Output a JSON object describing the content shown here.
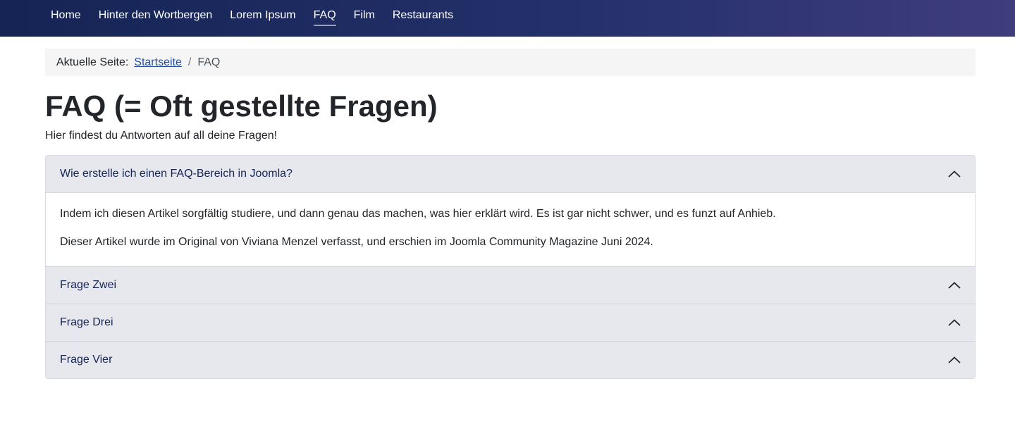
{
  "nav": {
    "items": [
      {
        "label": "Home",
        "active": false
      },
      {
        "label": "Hinter den Wortbergen",
        "active": false
      },
      {
        "label": "Lorem Ipsum",
        "active": false
      },
      {
        "label": "FAQ",
        "active": true
      },
      {
        "label": "Film",
        "active": false
      },
      {
        "label": "Restaurants",
        "active": false
      }
    ]
  },
  "breadcrumb": {
    "label": "Aktuelle Seite:",
    "home": "Startseite",
    "separator": "/",
    "current": "FAQ"
  },
  "page": {
    "title": "FAQ (= Oft gestellte Fragen)",
    "intro": "Hier findest du Antworten auf all deine Fragen!"
  },
  "accordion": {
    "items": [
      {
        "question": "Wie erstelle ich einen FAQ-Bereich in Joomla?",
        "expanded": true,
        "answer": [
          "Indem ich diesen Artikel sorgfältig studiere, und dann genau das machen, was hier erklärt wird. Es ist gar nicht schwer, und es funzt auf Anhieb.",
          "Dieser Artikel wurde im Original von Viviana Menzel verfasst, und erschien im Joomla Community Magazine Juni 2024."
        ]
      },
      {
        "question": "Frage Zwei",
        "expanded": false
      },
      {
        "question": "Frage Drei",
        "expanded": false
      },
      {
        "question": "Frage Vier",
        "expanded": false
      }
    ]
  },
  "colors": {
    "nav_start": "#152454",
    "nav_end": "#3f3d7c",
    "link": "#264d9b",
    "accordion_header": "#e7e8ee",
    "accordion_title": "#152454"
  },
  "icons": {
    "accordion_toggle": "chevron-up-icon"
  }
}
